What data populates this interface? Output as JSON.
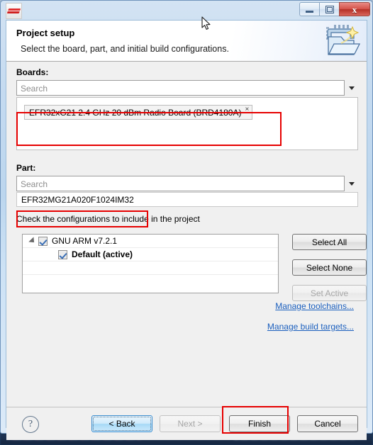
{
  "window": {
    "app_icon": "simplicity-studio-icon",
    "title": "",
    "controls": {
      "minimize": "–",
      "maximize": "□",
      "close": "x"
    }
  },
  "wizard": {
    "title": "Project setup",
    "subtitle": "Select the board, part, and initial build configurations.",
    "icon": "new-project-wizard-icon"
  },
  "boards": {
    "label": "Boards:",
    "search_placeholder": "Search",
    "search_value": "",
    "dropdown_icon": "chevron-down-icon",
    "selected": [
      {
        "label": "EFR32xG21 2.4 GHz 20 dBm Radio Board (BRD4180A)",
        "remove_icon": "×"
      }
    ]
  },
  "part": {
    "label": "Part:",
    "search_placeholder": "Search",
    "search_value": "",
    "dropdown_icon": "chevron-down-icon",
    "selected_value": "EFR32MG21A020F1024IM32"
  },
  "configurations": {
    "label": "Check the configurations to include in the project",
    "tree": [
      {
        "label": "GNU ARM v7.2.1",
        "checked": true,
        "expanded": true,
        "bold": false,
        "level": 0
      },
      {
        "label": "Default (active)",
        "checked": true,
        "expanded": null,
        "bold": true,
        "level": 1
      }
    ],
    "buttons": [
      {
        "label": "Select All",
        "enabled": true
      },
      {
        "label": "Select None",
        "enabled": true
      },
      {
        "label": "Set Active",
        "enabled": false
      }
    ]
  },
  "links": [
    {
      "label": "Manage toolchains...",
      "name": "manage-toolchains-link"
    },
    {
      "label": "Manage build targets...",
      "name": "manage-build-targets-link"
    }
  ],
  "footer": {
    "help_icon": "?",
    "buttons": [
      {
        "label": "< Back",
        "enabled": true,
        "focused": true,
        "highlighted": false
      },
      {
        "label": "Next >",
        "enabled": false,
        "focused": false,
        "highlighted": false
      },
      {
        "label": "Finish",
        "enabled": true,
        "focused": false,
        "highlighted": true
      },
      {
        "label": "Cancel",
        "enabled": true,
        "focused": false,
        "highlighted": false
      }
    ]
  },
  "annotations": {
    "color": "#e60000",
    "boxes": [
      "board-selection-highlight",
      "part-value-highlight",
      "finish-button-highlight"
    ]
  }
}
